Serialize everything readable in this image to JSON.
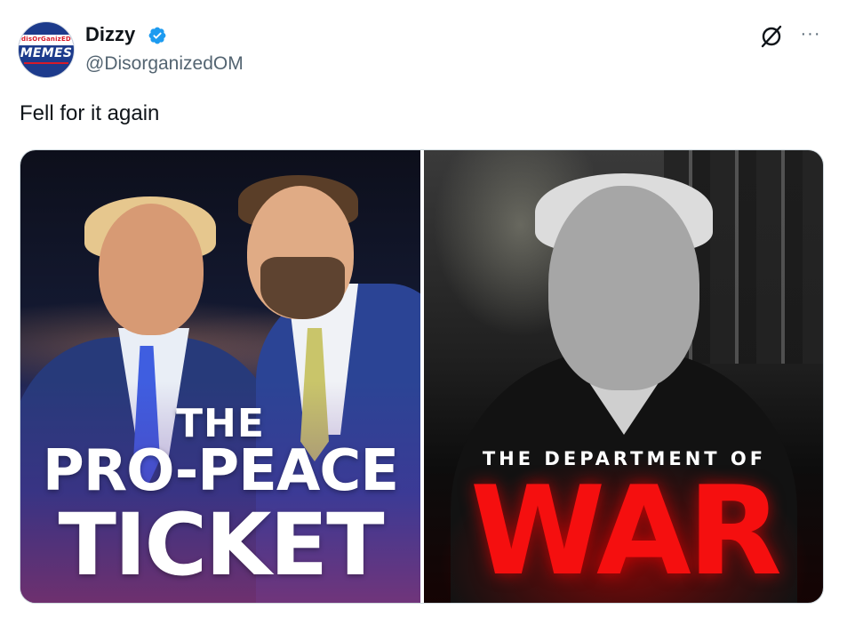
{
  "user": {
    "display_name": "Dizzy",
    "handle": "@DisorganizedOM",
    "verified": true,
    "avatar": {
      "top_text": "disOrGanizED",
      "main_text": "MEMES",
      "bg_color": "#1d3b8c",
      "accent_color": "#d71a28"
    }
  },
  "header_actions": {
    "grok_icon": "grok-icon",
    "more_icon": "more-icon",
    "more_label": "···"
  },
  "tweet": {
    "text": "Fell for it again"
  },
  "media": {
    "left_image": {
      "line1": "THE",
      "line2": "PRO-PEACE",
      "line3": "TICKET"
    },
    "right_image": {
      "line1": "THE DEPARTMENT OF",
      "line2": "WAR"
    }
  },
  "colors": {
    "verified_blue": "#1d9bf0",
    "text_primary": "#0f1419",
    "text_secondary": "#536471",
    "war_red": "#f50f0f"
  }
}
